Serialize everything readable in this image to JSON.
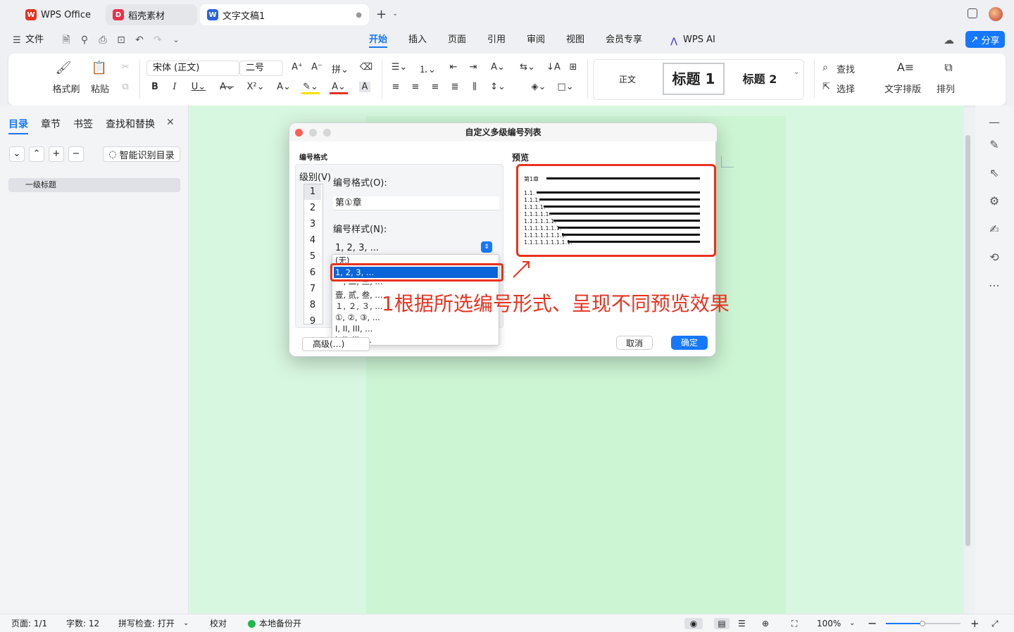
{
  "tabs": [
    {
      "label": "WPS Office",
      "icon": "wps-logo-icon"
    },
    {
      "label": "稻壳素材",
      "icon": "docer-icon"
    },
    {
      "label": "文字文稿1",
      "icon": "writer-doc-icon"
    }
  ],
  "menu": {
    "file": "文件",
    "items": [
      "开始",
      "插入",
      "页面",
      "引用",
      "审阅",
      "视图",
      "会员专享"
    ],
    "active": "开始",
    "ai": "WPS AI",
    "share": "分享"
  },
  "ribbon": {
    "format_painter": "格式刷",
    "paste": "粘贴",
    "font_name": "宋体 (正文)",
    "font_size": "二号",
    "styles": [
      "正文",
      "标题 1",
      "标题 2"
    ],
    "find": "查找",
    "select": "选择",
    "text_layout": "文字排版",
    "arrange": "排列"
  },
  "left_panel": {
    "tabs": [
      "目录",
      "章节",
      "书签",
      "查找和替换"
    ],
    "active_tab": "目录",
    "smart_toc": "智能识别目录",
    "toc_item": "一级标题"
  },
  "dialog": {
    "title": "自定义多级编号列表",
    "section_label": "编号格式",
    "level_label": "级别(V)",
    "levels": [
      "1",
      "2",
      "3",
      "4",
      "5",
      "6",
      "7",
      "8",
      "9"
    ],
    "number_format_label": "编号格式(O):",
    "number_format_value": "第①章",
    "number_style_label": "编号样式(N):",
    "number_style_value": "1, 2, 3, ...",
    "style_options": [
      "(无)",
      "1, 2, 3, ...",
      "一, 二, 三, ...",
      "壹, 贰, 叁, ...",
      "１, ２, ３, ...",
      "①, ②, ③, ...",
      "I, II, III, ...",
      "i, ii, iii, ..."
    ],
    "selected_option": "1, 2, 3, ...",
    "advanced_button": "高级(…)",
    "preview_label": "预览",
    "preview_lines": [
      "第1章",
      "1.1.",
      "1.1.1.",
      "1.1.1.1.",
      "1.1.1.1.1.",
      "1.1.1.1.1.1.",
      "1.1.1.1.1.1.1.",
      "1.1.1.1.1.1.1.1.",
      "1.1.1.1.1.1.1.1.1."
    ],
    "cancel": "取消",
    "ok": "确定"
  },
  "annotation": {
    "text": "1根据所选编号形式、呈现不同预览效果",
    "color": "#e8321f"
  },
  "status_bar": {
    "page": "页面: 1/1",
    "words": "字数: 12",
    "spell": "拼写检查: 打开",
    "proof": "校对",
    "backup": "本地备份开",
    "zoom": "100%"
  },
  "colors": {
    "accent": "#1677ff",
    "selection": "#0a64d8",
    "doc_background": "#d8f7e0"
  }
}
